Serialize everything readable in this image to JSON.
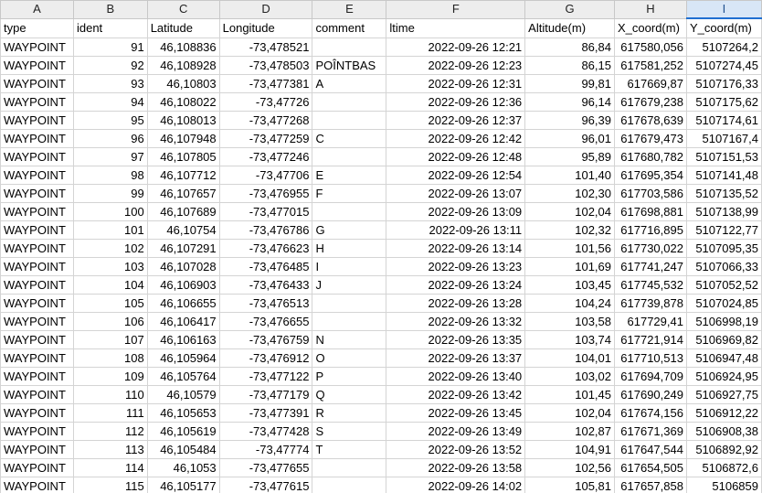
{
  "column_letters": [
    "A",
    "B",
    "C",
    "D",
    "E",
    "F",
    "G",
    "H",
    "I"
  ],
  "selected_column": "I",
  "headers": [
    "type",
    "ident",
    "Latitude",
    "Longitude",
    "comment",
    "ltime",
    "Altitude(m)",
    "X_coord(m)",
    "Y_coord(m)"
  ],
  "rows": [
    [
      "WAYPOINT",
      "91",
      "46,108836",
      "-73,478521",
      "",
      "2022-09-26 12:21",
      "86,84",
      "617580,056",
      "5107264,2"
    ],
    [
      "WAYPOINT",
      "92",
      "46,108928",
      "-73,478503",
      "POÎNTBAS",
      "2022-09-26 12:23",
      "86,15",
      "617581,252",
      "5107274,45"
    ],
    [
      "WAYPOINT",
      "93",
      "46,10803",
      "-73,477381",
      "A",
      "2022-09-26 12:31",
      "99,81",
      "617669,87",
      "5107176,33"
    ],
    [
      "WAYPOINT",
      "94",
      "46,108022",
      "-73,47726",
      "",
      "2022-09-26 12:36",
      "96,14",
      "617679,238",
      "5107175,62"
    ],
    [
      "WAYPOINT",
      "95",
      "46,108013",
      "-73,477268",
      "",
      "2022-09-26 12:37",
      "96,39",
      "617678,639",
      "5107174,61"
    ],
    [
      "WAYPOINT",
      "96",
      "46,107948",
      "-73,477259",
      "C",
      "2022-09-26 12:42",
      "96,01",
      "617679,473",
      "5107167,4"
    ],
    [
      "WAYPOINT",
      "97",
      "46,107805",
      "-73,477246",
      "",
      "2022-09-26 12:48",
      "95,89",
      "617680,782",
      "5107151,53"
    ],
    [
      "WAYPOINT",
      "98",
      "46,107712",
      "-73,47706",
      "E",
      "2022-09-26 12:54",
      "101,40",
      "617695,354",
      "5107141,48"
    ],
    [
      "WAYPOINT",
      "99",
      "46,107657",
      "-73,476955",
      "F",
      "2022-09-26 13:07",
      "102,30",
      "617703,586",
      "5107135,52"
    ],
    [
      "WAYPOINT",
      "100",
      "46,107689",
      "-73,477015",
      "",
      "2022-09-26 13:09",
      "102,04",
      "617698,881",
      "5107138,99"
    ],
    [
      "WAYPOINT",
      "101",
      "46,10754",
      "-73,476786",
      "G",
      "2022-09-26 13:11",
      "102,32",
      "617716,895",
      "5107122,77"
    ],
    [
      "WAYPOINT",
      "102",
      "46,107291",
      "-73,476623",
      "H",
      "2022-09-26 13:14",
      "101,56",
      "617730,022",
      "5107095,35"
    ],
    [
      "WAYPOINT",
      "103",
      "46,107028",
      "-73,476485",
      "I",
      "2022-09-26 13:23",
      "101,69",
      "617741,247",
      "5107066,33"
    ],
    [
      "WAYPOINT",
      "104",
      "46,106903",
      "-73,476433",
      "J",
      "2022-09-26 13:24",
      "103,45",
      "617745,532",
      "5107052,52"
    ],
    [
      "WAYPOINT",
      "105",
      "46,106655",
      "-73,476513",
      "",
      "2022-09-26 13:28",
      "104,24",
      "617739,878",
      "5107024,85"
    ],
    [
      "WAYPOINT",
      "106",
      "46,106417",
      "-73,476655",
      "",
      "2022-09-26 13:32",
      "103,58",
      "617729,41",
      "5106998,19"
    ],
    [
      "WAYPOINT",
      "107",
      "46,106163",
      "-73,476759",
      "N",
      "2022-09-26 13:35",
      "103,74",
      "617721,914",
      "5106969,82"
    ],
    [
      "WAYPOINT",
      "108",
      "46,105964",
      "-73,476912",
      "O",
      "2022-09-26 13:37",
      "104,01",
      "617710,513",
      "5106947,48"
    ],
    [
      "WAYPOINT",
      "109",
      "46,105764",
      "-73,477122",
      "P",
      "2022-09-26 13:40",
      "103,02",
      "617694,709",
      "5106924,95"
    ],
    [
      "WAYPOINT",
      "110",
      "46,10579",
      "-73,477179",
      "Q",
      "2022-09-26 13:42",
      "101,45",
      "617690,249",
      "5106927,75"
    ],
    [
      "WAYPOINT",
      "111",
      "46,105653",
      "-73,477391",
      "R",
      "2022-09-26 13:45",
      "102,04",
      "617674,156",
      "5106912,22"
    ],
    [
      "WAYPOINT",
      "112",
      "46,105619",
      "-73,477428",
      "S",
      "2022-09-26 13:49",
      "102,87",
      "617671,369",
      "5106908,38"
    ],
    [
      "WAYPOINT",
      "113",
      "46,105484",
      "-73,47774",
      "T",
      "2022-09-26 13:52",
      "104,91",
      "617647,544",
      "5106892,92"
    ],
    [
      "WAYPOINT",
      "114",
      "46,1053",
      "-73,477655",
      "",
      "2022-09-26 13:58",
      "102,56",
      "617654,505",
      "5106872,6"
    ],
    [
      "WAYPOINT",
      "115",
      "46,105177",
      "-73,477615",
      "",
      "2022-09-26 14:02",
      "105,81",
      "617657,858",
      "5106859"
    ]
  ]
}
